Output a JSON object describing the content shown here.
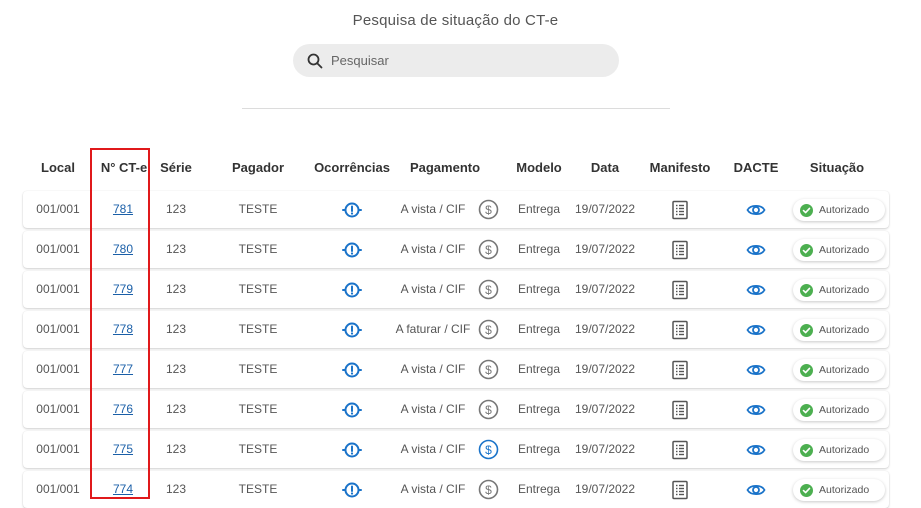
{
  "page": {
    "title": "Pesquisa de situação do CT-e"
  },
  "search": {
    "placeholder": "Pesquisar",
    "value": ""
  },
  "table": {
    "headers": {
      "local": "Local",
      "numero": "N° CT-e",
      "serie": "Série",
      "pagador": "Pagador",
      "ocorrencias": "Ocorrências",
      "pagamento": "Pagamento",
      "modelo": "Modelo",
      "data": "Data",
      "manifesto": "Manifesto",
      "dacte": "DACTE",
      "situacao": "Situação"
    },
    "rows": [
      {
        "local": "001/001",
        "numero": "781",
        "serie": "123",
        "pagador": "TESTE",
        "pagamento": "A vista / CIF",
        "modelo": "Entrega",
        "data": "19/07/2022",
        "situacao": "Autorizado",
        "payment_icon_color": "#777777"
      },
      {
        "local": "001/001",
        "numero": "780",
        "serie": "123",
        "pagador": "TESTE",
        "pagamento": "A vista / CIF",
        "modelo": "Entrega",
        "data": "19/07/2022",
        "situacao": "Autorizado",
        "payment_icon_color": "#777777"
      },
      {
        "local": "001/001",
        "numero": "779",
        "serie": "123",
        "pagador": "TESTE",
        "pagamento": "A vista / CIF",
        "modelo": "Entrega",
        "data": "19/07/2022",
        "situacao": "Autorizado",
        "payment_icon_color": "#777777"
      },
      {
        "local": "001/001",
        "numero": "778",
        "serie": "123",
        "pagador": "TESTE",
        "pagamento": "A faturar / CIF",
        "modelo": "Entrega",
        "data": "19/07/2022",
        "situacao": "Autorizado",
        "payment_icon_color": "#777777"
      },
      {
        "local": "001/001",
        "numero": "777",
        "serie": "123",
        "pagador": "TESTE",
        "pagamento": "A vista / CIF",
        "modelo": "Entrega",
        "data": "19/07/2022",
        "situacao": "Autorizado",
        "payment_icon_color": "#777777"
      },
      {
        "local": "001/001",
        "numero": "776",
        "serie": "123",
        "pagador": "TESTE",
        "pagamento": "A vista / CIF",
        "modelo": "Entrega",
        "data": "19/07/2022",
        "situacao": "Autorizado",
        "payment_icon_color": "#777777"
      },
      {
        "local": "001/001",
        "numero": "775",
        "serie": "123",
        "pagador": "TESTE",
        "pagamento": "A vista / CIF",
        "modelo": "Entrega",
        "data": "19/07/2022",
        "situacao": "Autorizado",
        "payment_icon_color": "#1a73c9"
      },
      {
        "local": "001/001",
        "numero": "774",
        "serie": "123",
        "pagador": "TESTE",
        "pagamento": "A vista / CIF",
        "modelo": "Entrega",
        "data": "19/07/2022",
        "situacao": "Autorizado",
        "payment_icon_color": "#777777"
      }
    ]
  },
  "icons": {
    "ocorrencias": "alert-circle-icon",
    "pagamento": "dollar-circle-icon",
    "manifesto": "document-list-icon",
    "dacte": "eye-icon",
    "situacao": "check-circle-icon"
  },
  "colors": {
    "accent_blue": "#1a73c9",
    "status_green": "#4caf50",
    "highlight_red": "#e0191b",
    "link": "#1a5fa8"
  }
}
